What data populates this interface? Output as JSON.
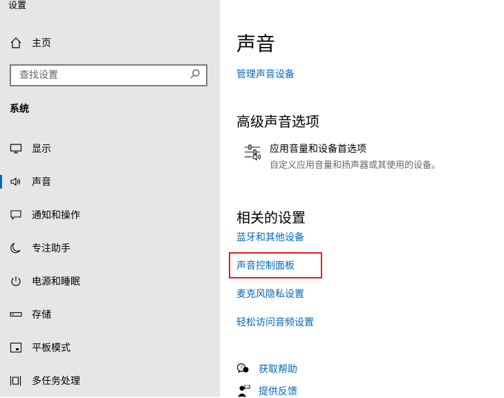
{
  "app": {
    "title": "设置"
  },
  "sidebar": {
    "home_label": "主页",
    "search_placeholder": "查找设置",
    "section": "系统",
    "items": [
      {
        "label": "显示",
        "icon": "monitor-icon"
      },
      {
        "label": "声音",
        "icon": "speaker-icon",
        "active": true
      },
      {
        "label": "通知和操作",
        "icon": "notification-icon"
      },
      {
        "label": "专注助手",
        "icon": "moon-icon"
      },
      {
        "label": "电源和睡眠",
        "icon": "power-icon"
      },
      {
        "label": "存储",
        "icon": "storage-icon"
      },
      {
        "label": "平板模式",
        "icon": "tablet-icon"
      },
      {
        "label": "多任务处理",
        "icon": "multitask-icon"
      }
    ]
  },
  "main": {
    "title": "声音",
    "manage_link": "管理声音设备",
    "advanced": {
      "heading": "高级声音选项",
      "option_title": "应用音量和设备首选项",
      "option_desc": "自定义应用音量和扬声器或其使用的设备。"
    },
    "related": {
      "heading": "相关的设置",
      "links": [
        "蓝牙和其他设备",
        "声音控制面板",
        "麦克风隐私设置",
        "轻松访问音频设置"
      ]
    },
    "help": {
      "get_help": "获取帮助",
      "feedback": "提供反馈"
    }
  },
  "colors": {
    "accent": "#0067c0",
    "highlight": "#e11d1d",
    "sidebar_bg": "#e6e6e6"
  }
}
